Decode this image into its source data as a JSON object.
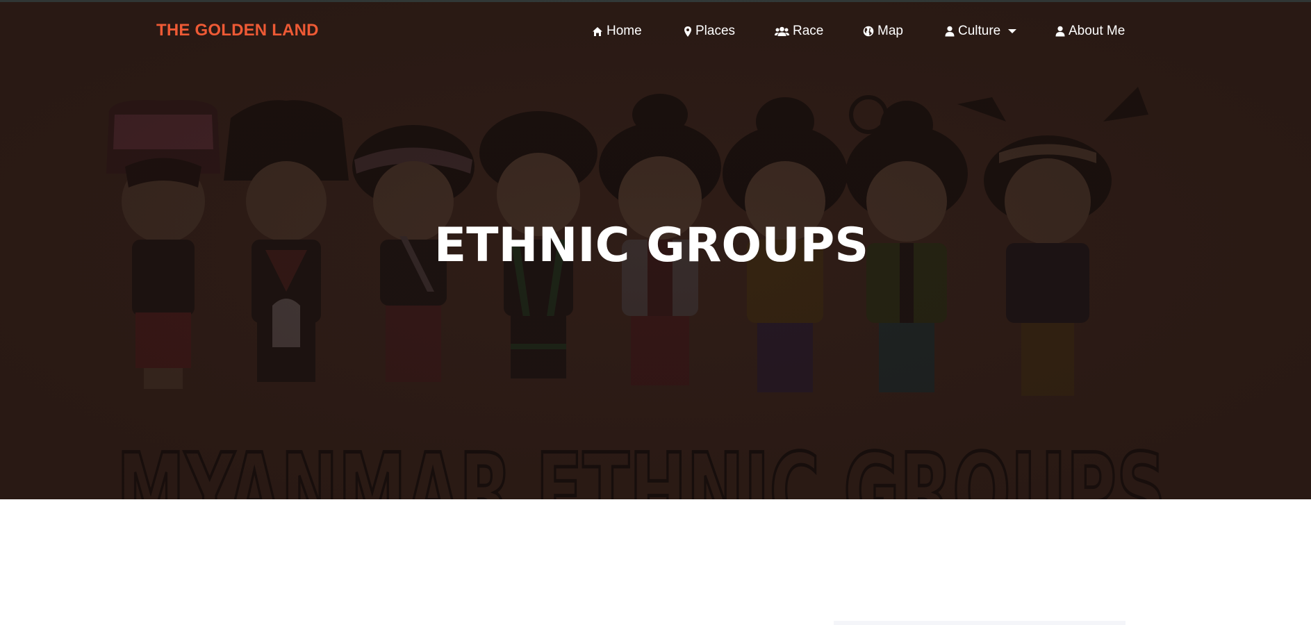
{
  "brand": {
    "name": "THE GOLDEN LAND"
  },
  "nav": {
    "items": [
      {
        "label": "Home",
        "icon": "home-icon"
      },
      {
        "label": "Places",
        "icon": "map-marker-icon"
      },
      {
        "label": "Race",
        "icon": "users-icon"
      },
      {
        "label": "Map",
        "icon": "globe-icon"
      },
      {
        "label": "Culture",
        "icon": "user-icon",
        "dropdown": true
      },
      {
        "label": "About Me",
        "icon": "user-icon"
      }
    ]
  },
  "hero": {
    "title": "ETHNIC GROUPS",
    "background_image_text": "MYANMAR ETHNIC GROUPS"
  },
  "colors": {
    "brand": "#ee5a35",
    "hero_bg": "#2f1d17",
    "nav_text": "#ffffff"
  }
}
